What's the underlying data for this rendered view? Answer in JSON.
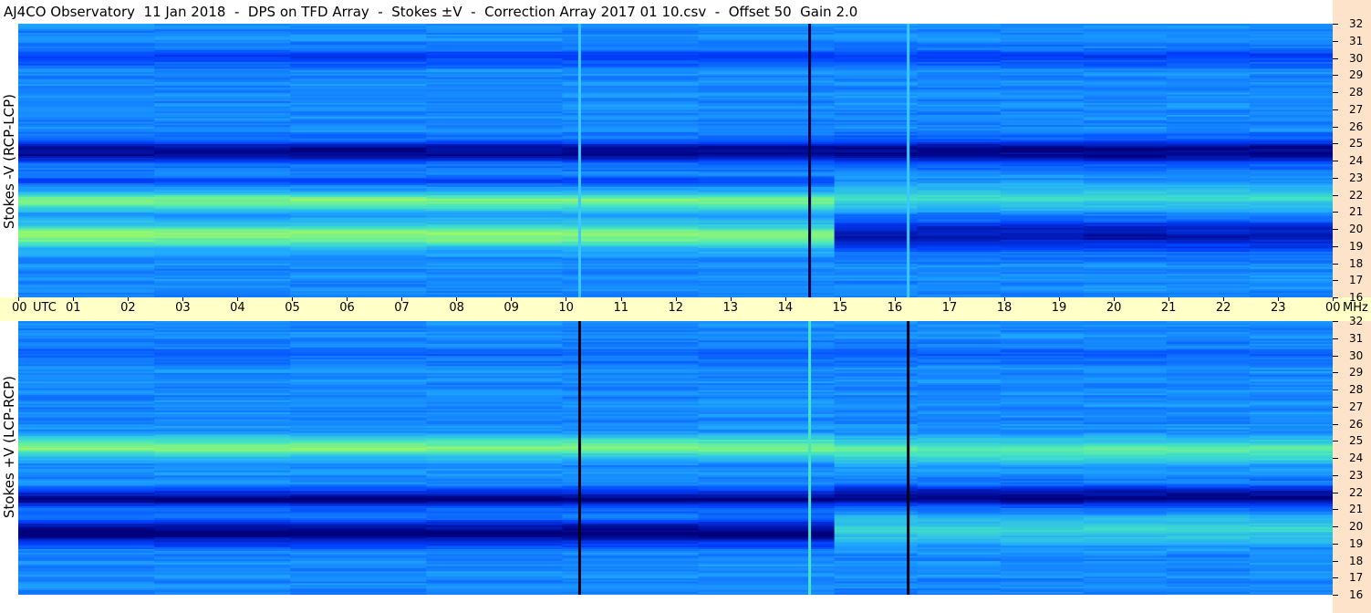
{
  "title": "AJ4CO Observatory  11 Jan 2018  -  DPS on TFD Array  -  Stokes ±V  -  Correction Array 2017 01 10.csv  -  Offset 50  Gain 2.0",
  "colors": {
    "freq_axis_bg": "#fde3c9",
    "time_axis_bg": "#ffffc8",
    "colormap": [
      "#00007f",
      "#0040ff",
      "#1fa8ff",
      "#44e5c2",
      "#b8ff47",
      "#ffbb00",
      "#ff3300"
    ]
  },
  "chart_data": [
    {
      "type": "heatmap",
      "ylabel": "Stokes -V (RCP-LCP)",
      "yunit": "MHz",
      "ylim": [
        16,
        32
      ],
      "y_ticks": [
        "16",
        "17",
        "18",
        "19",
        "20",
        "21",
        "22",
        "23",
        "24",
        "25",
        "26",
        "27",
        "28",
        "29",
        "30",
        "31",
        "32"
      ],
      "time_ticks": [
        "00",
        "01",
        "02",
        "03",
        "04",
        "05",
        "06",
        "07",
        "08",
        "09",
        "10",
        "11",
        "12",
        "13",
        "14",
        "15",
        "16",
        "17",
        "18",
        "19",
        "20",
        "21",
        "22",
        "23",
        "00"
      ],
      "time_unit": "UTC",
      "vertical_lines": [
        {
          "time": 10.25,
          "color": "#3ac8ff"
        },
        {
          "time": 14.45,
          "color": "#00004a"
        },
        {
          "time": 16.25,
          "color": "#3ac8ff"
        }
      ]
    },
    {
      "type": "heatmap",
      "ylabel": "Stokes +V (LCP-RCP)",
      "yunit": "MHz",
      "ylim": [
        16,
        32
      ],
      "y_ticks": [
        "16",
        "17",
        "18",
        "19",
        "20",
        "21",
        "22",
        "23",
        "24",
        "25",
        "26",
        "27",
        "28",
        "29",
        "30",
        "31",
        "32"
      ],
      "time_ticks": [
        "00",
        "01",
        "02",
        "03",
        "04",
        "05",
        "06",
        "07",
        "08",
        "09",
        "10",
        "11",
        "12",
        "13",
        "14",
        "15",
        "16",
        "17",
        "18",
        "19",
        "20",
        "21",
        "22",
        "23",
        "00"
      ],
      "time_unit": "UTC",
      "vertical_lines": [
        {
          "time": 10.25,
          "color": "#000010"
        },
        {
          "time": 14.45,
          "color": "#44e5c2"
        },
        {
          "time": 16.25,
          "color": "#000010"
        }
      ]
    }
  ]
}
